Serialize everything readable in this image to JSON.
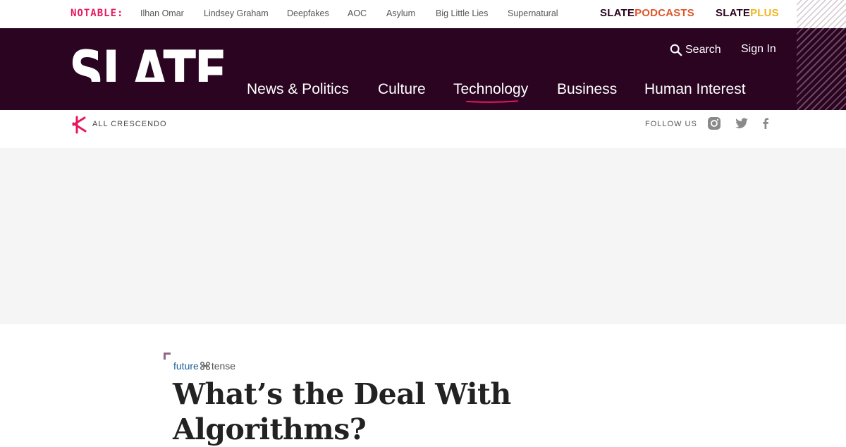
{
  "notable": {
    "label": "NOTABLE:",
    "links": [
      "Ilhan Omar",
      "Lindsey Graham",
      "Deepfakes",
      "AOC",
      "Asylum",
      "Big Little Lies",
      "Supernatural"
    ]
  },
  "brands": {
    "podcasts": {
      "prefix": "SLATE",
      "suffix": "PODCASTS"
    },
    "plus": {
      "prefix": "SLATE",
      "suffix": "PLUS"
    }
  },
  "header": {
    "logo_text": "SLATE",
    "search_label": "Search",
    "signin_label": "Sign In",
    "nav": [
      "News & Politics",
      "Culture",
      "Technology",
      "Business",
      "Human Interest"
    ],
    "active_nav": "Technology"
  },
  "subheader": {
    "crescendo_label": "ALL CRESCENDO",
    "follow_label": "FOLLOW US",
    "social_icons": [
      "instagram-icon",
      "twitter-icon",
      "facebook-icon"
    ]
  },
  "article": {
    "section_future": "future",
    "section_tense": "tense",
    "headline": "What’s the Deal With Algorithms?"
  },
  "colors": {
    "header_bg": "#2a0421",
    "accent_pink": "#e8175d",
    "podcasts_orange": "#e0552a",
    "plus_yellow": "#f1b51c",
    "ad_bg": "#f5f5f5"
  }
}
